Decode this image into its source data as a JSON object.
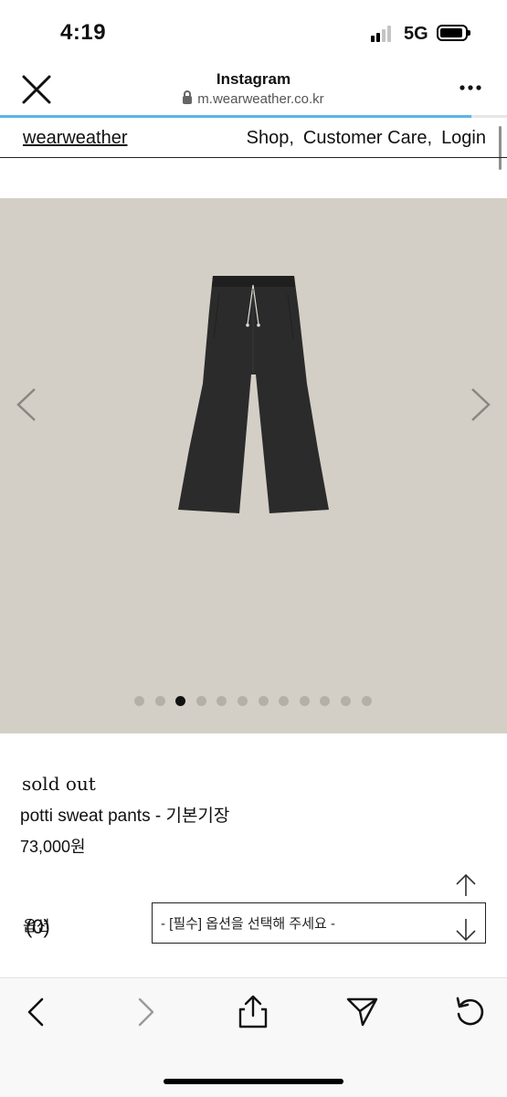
{
  "status_bar": {
    "time": "4:19",
    "network": "5G"
  },
  "browser": {
    "title": "Instagram",
    "url": "m.wearweather.co.kr",
    "load_progress": 0.93
  },
  "site": {
    "logo": "wearweather",
    "nav": [
      "Shop,",
      "Customer Care,",
      "Login"
    ]
  },
  "gallery": {
    "total_images": 12,
    "active_index": 2
  },
  "product": {
    "status": "sold out",
    "name": "potti sweat pants - 기본기장",
    "price": "73,000원"
  },
  "options": {
    "label": "옵션",
    "cart_count": "(0)",
    "select_value": "- [필수] 옵션을 선택해 주세요 -"
  },
  "icons": {
    "close": "close-icon",
    "more": "more-icon",
    "lock": "lock-icon",
    "prev": "chevron-left-icon",
    "next": "chevron-right-icon",
    "scroll_up": "arrow-up-icon",
    "scroll_down": "arrow-down-icon",
    "toolbar": [
      "back-icon",
      "forward-icon",
      "share-icon",
      "send-icon",
      "reload-icon"
    ]
  },
  "colors": {
    "image_background": "#d4cfc6",
    "progress": "#5bb4e6",
    "garment": "#2b2b2b"
  }
}
